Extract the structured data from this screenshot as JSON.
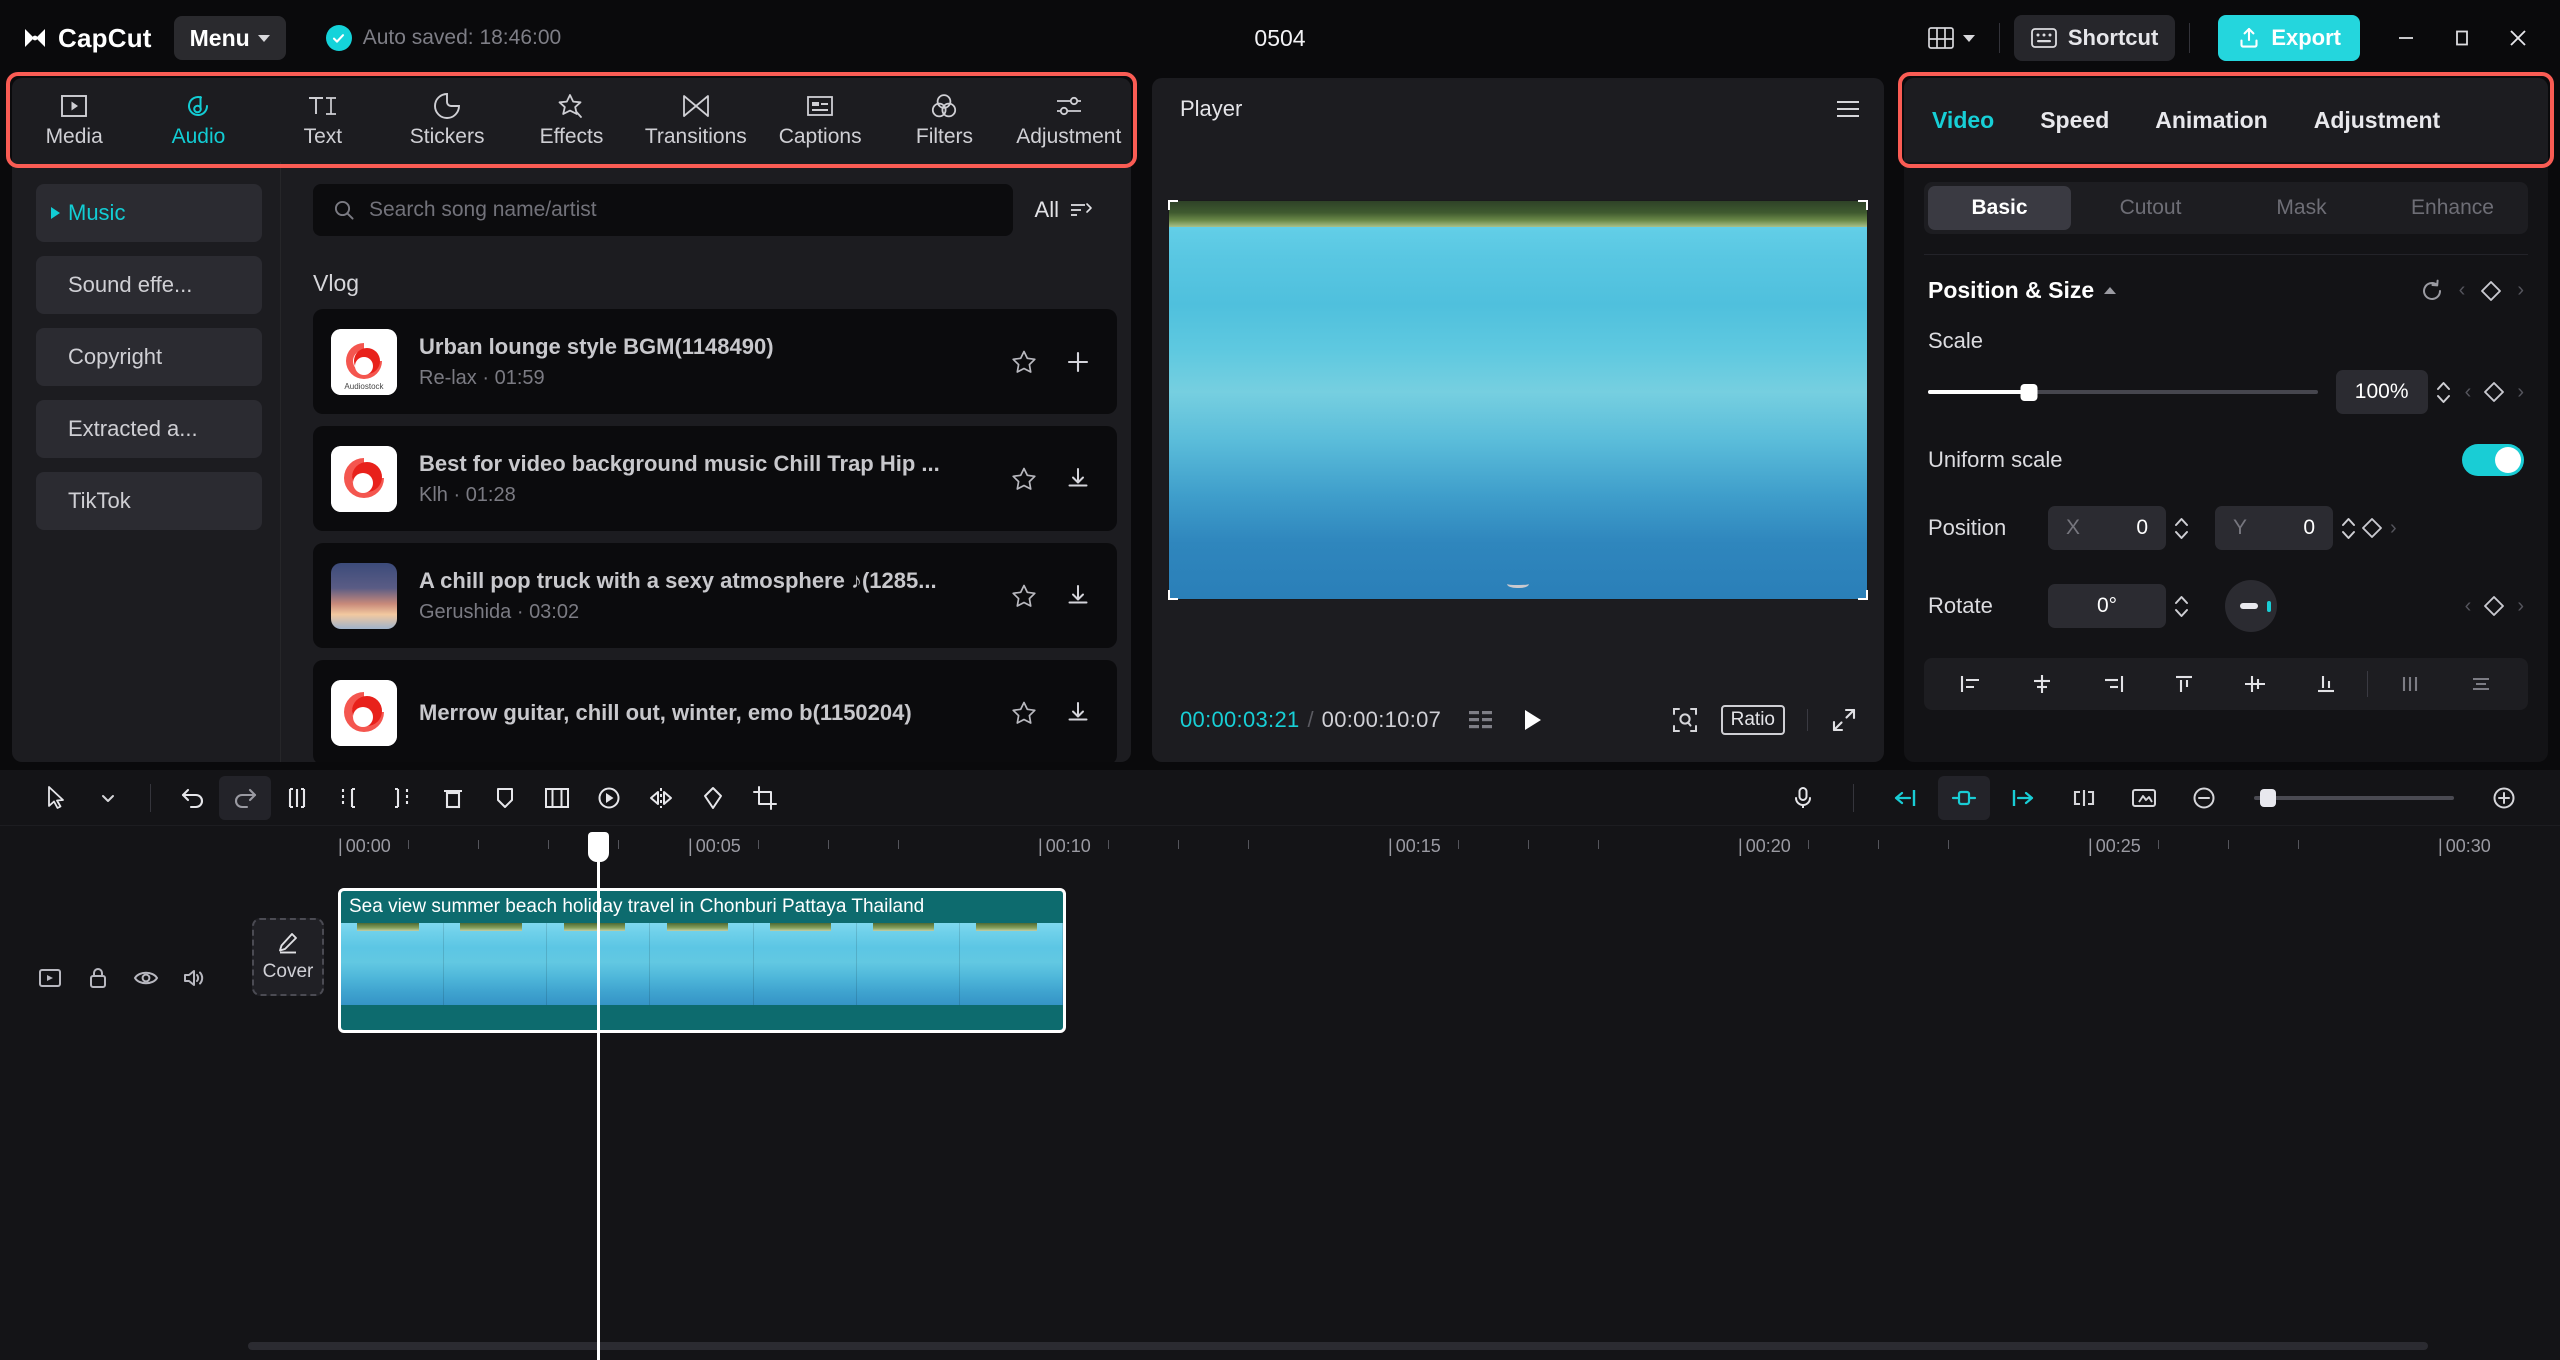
{
  "titlebar": {
    "brand": "CapCut",
    "menu_label": "Menu",
    "autosave_text": "Auto saved: 18:46:00",
    "project_title": "0504",
    "shortcut_label": "Shortcut",
    "export_label": "Export",
    "accent_color": "#24d6dd",
    "window_buttons": [
      "minimize-button",
      "maximize-button",
      "close-button"
    ]
  },
  "tool_tabs": [
    {
      "label": "Media",
      "icon": "media-icon",
      "active": false
    },
    {
      "label": "Audio",
      "icon": "audio-note-icon",
      "active": true
    },
    {
      "label": "Text",
      "icon": "text-ti-icon",
      "active": false
    },
    {
      "label": "Stickers",
      "icon": "sticker-icon",
      "active": false
    },
    {
      "label": "Effects",
      "icon": "effects-star-icon",
      "active": false
    },
    {
      "label": "Transitions",
      "icon": "transitions-icon",
      "active": false
    },
    {
      "label": "Captions",
      "icon": "captions-icon",
      "active": false
    },
    {
      "label": "Filters",
      "icon": "filters-icon",
      "active": false
    },
    {
      "label": "Adjustment",
      "icon": "adjustment-icon",
      "active": false
    }
  ],
  "library": {
    "categories": [
      {
        "label": "Music",
        "active": true,
        "has_arrow": true
      },
      {
        "label": "Sound effe...",
        "active": false,
        "has_arrow": false
      },
      {
        "label": "Copyright",
        "active": false,
        "has_arrow": false
      },
      {
        "label": "Extracted a...",
        "active": false,
        "has_arrow": false
      },
      {
        "label": "TikTok",
        "active": false,
        "has_arrow": false
      }
    ],
    "search_placeholder": "Search song name/artist",
    "filter_label": "All",
    "section_label": "Vlog",
    "songs": [
      {
        "title": "Urban lounge style BGM(1148490)",
        "artist": "Re-lax",
        "duration": "01:59",
        "cover": "audiostock",
        "action": "add"
      },
      {
        "title": "Best for video background music Chill Trap Hip ...",
        "artist": "Klh",
        "duration": "01:28",
        "cover": "audiostock",
        "action": "download"
      },
      {
        "title": "A chill pop truck with a sexy atmosphere ♪(1285...",
        "artist": "Gerushida",
        "duration": "03:02",
        "cover": "photo",
        "action": "download"
      },
      {
        "title": "Merrow guitar, chill out, winter, emo b(1150204)",
        "artist": "",
        "duration": "",
        "cover": "audiostock",
        "action": "download"
      }
    ]
  },
  "player": {
    "title": "Player",
    "current_time": "00:00:03:21",
    "total_time": "00:00:10:07",
    "separator": "/",
    "ratio_label": "Ratio",
    "icons": [
      "menu-hamburger-icon",
      "grid-frames-icon",
      "play-icon",
      "crop-zoom-icon",
      "fullscreen-icon"
    ]
  },
  "properties": {
    "tabs": [
      {
        "label": "Video",
        "active": true
      },
      {
        "label": "Speed",
        "active": false
      },
      {
        "label": "Animation",
        "active": false
      },
      {
        "label": "Adjustment",
        "active": false
      }
    ],
    "subtabs": [
      {
        "label": "Basic",
        "active": true
      },
      {
        "label": "Cutout",
        "active": false
      },
      {
        "label": "Mask",
        "active": false
      },
      {
        "label": "Enhance",
        "active": false
      }
    ],
    "section_title": "Position & Size",
    "scale": {
      "label": "Scale",
      "value": "100%",
      "fill_percent": 26
    },
    "uniform_scale": {
      "label": "Uniform scale",
      "enabled": true
    },
    "position": {
      "label": "Position",
      "x_axis": "X",
      "x_value": "0",
      "y_axis": "Y",
      "y_value": "0"
    },
    "rotate": {
      "label": "Rotate",
      "value": "0°"
    },
    "align_buttons": [
      "align-left-icon",
      "align-center-horizontal-icon",
      "align-right-icon",
      "align-top-icon",
      "align-middle-vertical-icon",
      "align-bottom-icon",
      "distribute-horizontal-icon",
      "distribute-vertical-icon"
    ]
  },
  "timeline": {
    "toolbar_left": [
      "select-cursor-icon",
      "cursor-dropdown-icon",
      "undo-icon",
      "redo-icon",
      "split-icon",
      "trim-left-icon",
      "trim-right-icon",
      "delete-icon",
      "mark-icon",
      "mirror-frames-icon",
      "freeze-frame-icon",
      "flip-icon",
      "color-picker-icon",
      "crop-icon"
    ],
    "toolbar_right": [
      "microphone-icon",
      "snap-left-icon",
      "magnet-snap-icon",
      "snap-right-icon",
      "link-clips-icon",
      "preview-scale-icon",
      "zoom-out-icon",
      "zoom-in-icon"
    ],
    "ruler_ticks": [
      "00:00",
      "00:05",
      "00:10",
      "00:15",
      "00:20",
      "00:25",
      "00:30"
    ],
    "track_icons": [
      "export-track-icon",
      "lock-icon",
      "eye-icon",
      "volume-icon"
    ],
    "cover_label": "Cover",
    "clip": {
      "title": "Sea view summer beach holiday travel in Chonburi Pattaya Thailand",
      "color": "#0d6b6e",
      "thumb_count": 7
    }
  },
  "highlights": {
    "toolbar_box_color": "#fa5c54",
    "properties_box_color": "#fa5c54"
  }
}
